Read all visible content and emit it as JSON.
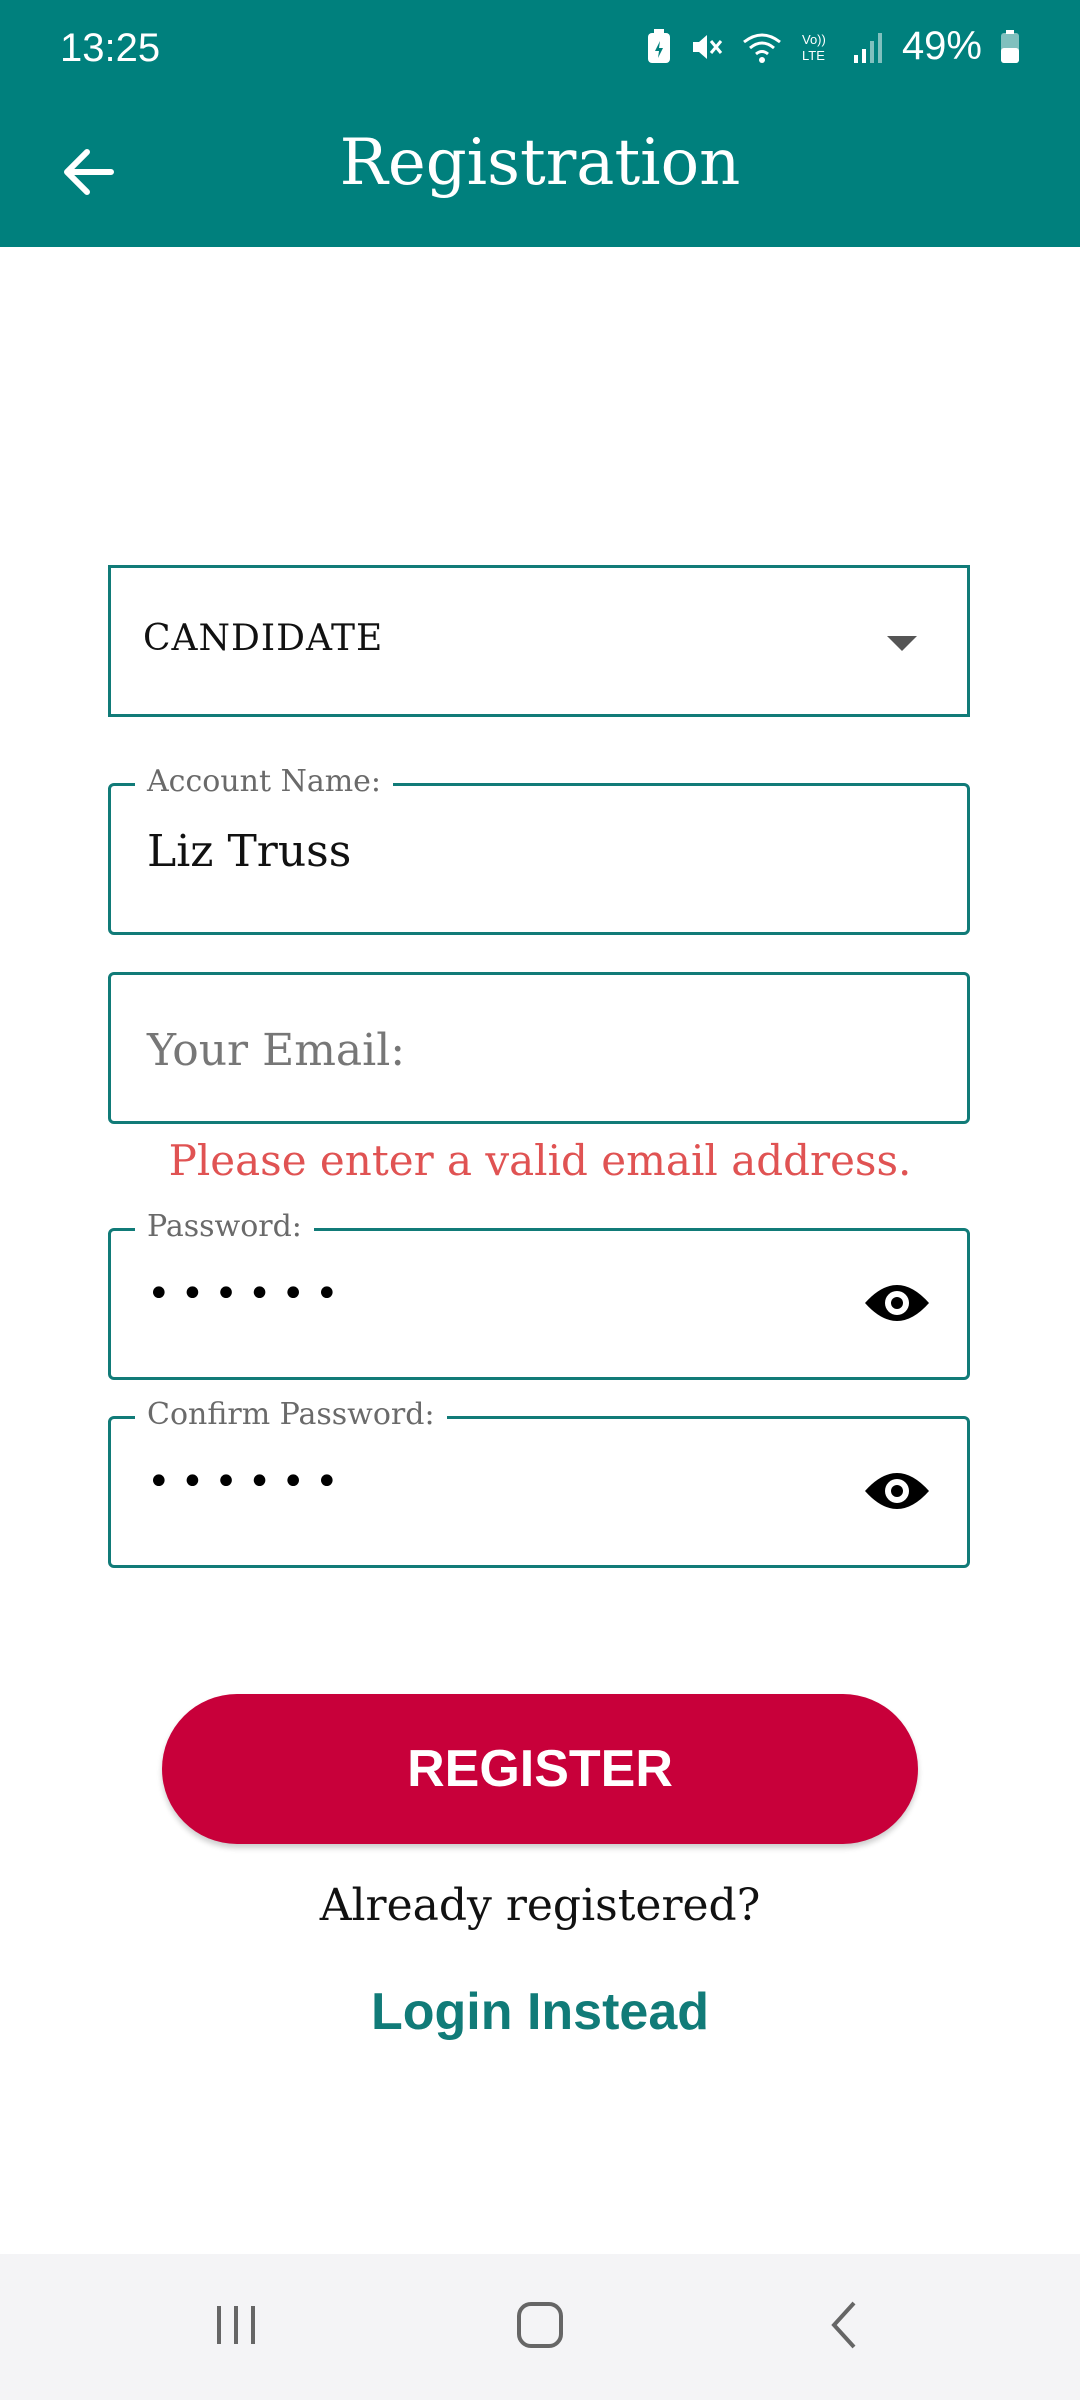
{
  "status_bar": {
    "time": "13:25",
    "battery_percent": "49%"
  },
  "app_bar": {
    "title": "Registration",
    "back_icon": "arrow-left-icon"
  },
  "form": {
    "account_type": {
      "selected": "CANDIDATE"
    },
    "account_name": {
      "label": "Account Name:",
      "value": "Liz Truss"
    },
    "email": {
      "placeholder": "Your Email:",
      "value": "",
      "error": "Please enter a valid email address."
    },
    "password": {
      "label": "Password:",
      "masked_value": "••••••",
      "toggle_icon": "eye-icon"
    },
    "confirm_password": {
      "label": "Confirm Password:",
      "masked_value": "••••••",
      "toggle_icon": "eye-icon"
    },
    "register_label": "REGISTER",
    "already_registered": "Already registered?",
    "login_link": "Login Instead"
  },
  "colors": {
    "primary": "#00807d",
    "accent": "#c8003a",
    "error": "#e05353",
    "link": "#117b78"
  },
  "nav_bar": {
    "icons": [
      "recents-icon",
      "home-icon",
      "back-icon"
    ]
  }
}
